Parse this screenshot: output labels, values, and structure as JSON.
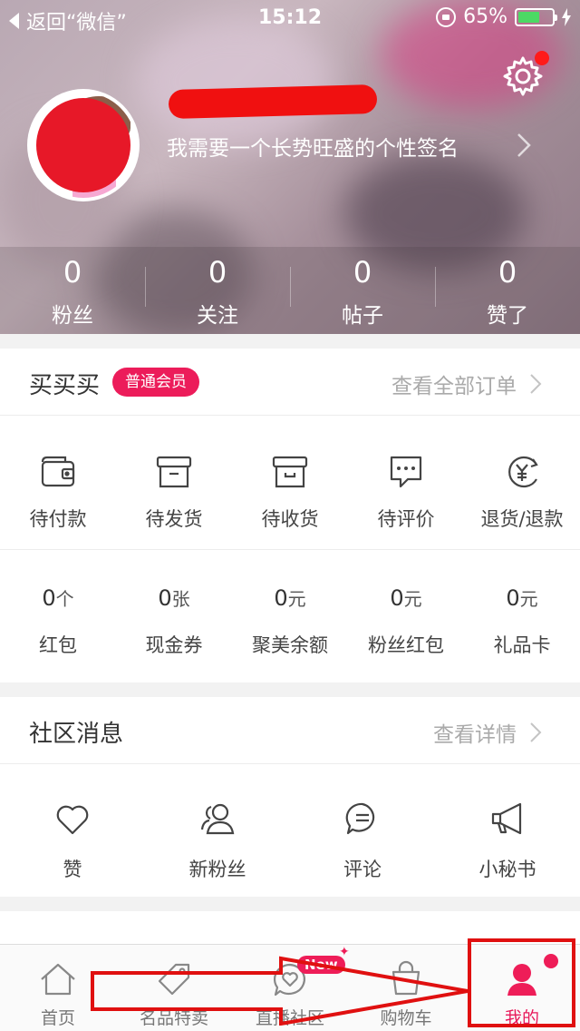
{
  "status_bar": {
    "back_label": "返回“微信”",
    "time": "15:12",
    "battery": "65%",
    "battery_level": 0.65
  },
  "profile": {
    "signature": "我需要一个长势旺盛的个性签名"
  },
  "stats": [
    {
      "value": "0",
      "label": "粉丝"
    },
    {
      "value": "0",
      "label": "关注"
    },
    {
      "value": "0",
      "label": "帖子"
    },
    {
      "value": "0",
      "label": "赞了"
    }
  ],
  "shopping": {
    "title": "买买买",
    "badge": "普通会员",
    "link": "查看全部订单",
    "orders": [
      {
        "label": "待付款",
        "icon": "wallet-icon"
      },
      {
        "label": "待发货",
        "icon": "box-icon"
      },
      {
        "label": "待收货",
        "icon": "package-icon"
      },
      {
        "label": "待评价",
        "icon": "comment-bubble-icon"
      },
      {
        "label": "退货/退款",
        "icon": "refund-icon"
      }
    ],
    "assets": [
      {
        "value": "0",
        "unit": "个",
        "label": "红包"
      },
      {
        "value": "0",
        "unit": "张",
        "label": "现金券"
      },
      {
        "value": "0",
        "unit": "元",
        "label": "聚美余额"
      },
      {
        "value": "0",
        "unit": "元",
        "label": "粉丝红包"
      },
      {
        "value": "0",
        "unit": "元",
        "label": "礼品卡"
      }
    ]
  },
  "community": {
    "title": "社区消息",
    "link": "查看详情",
    "items": [
      {
        "label": "赞",
        "icon": "heart-icon"
      },
      {
        "label": "新粉丝",
        "icon": "followers-icon"
      },
      {
        "label": "评论",
        "icon": "comment-icon"
      },
      {
        "label": "小秘书",
        "icon": "megaphone-icon"
      }
    ]
  },
  "tabbar": {
    "new_badge": "New",
    "tabs": [
      {
        "label": "首页",
        "icon": "home-icon"
      },
      {
        "label": "名品特卖",
        "icon": "tag-icon"
      },
      {
        "label": "直播社区",
        "icon": "live-community-icon"
      },
      {
        "label": "购物车",
        "icon": "cart-icon"
      },
      {
        "label": "我的",
        "icon": "user-icon",
        "active": true
      }
    ]
  },
  "colors": {
    "accent": "#e8195a",
    "battery": "#4cd964",
    "annotation": "#e01010"
  }
}
